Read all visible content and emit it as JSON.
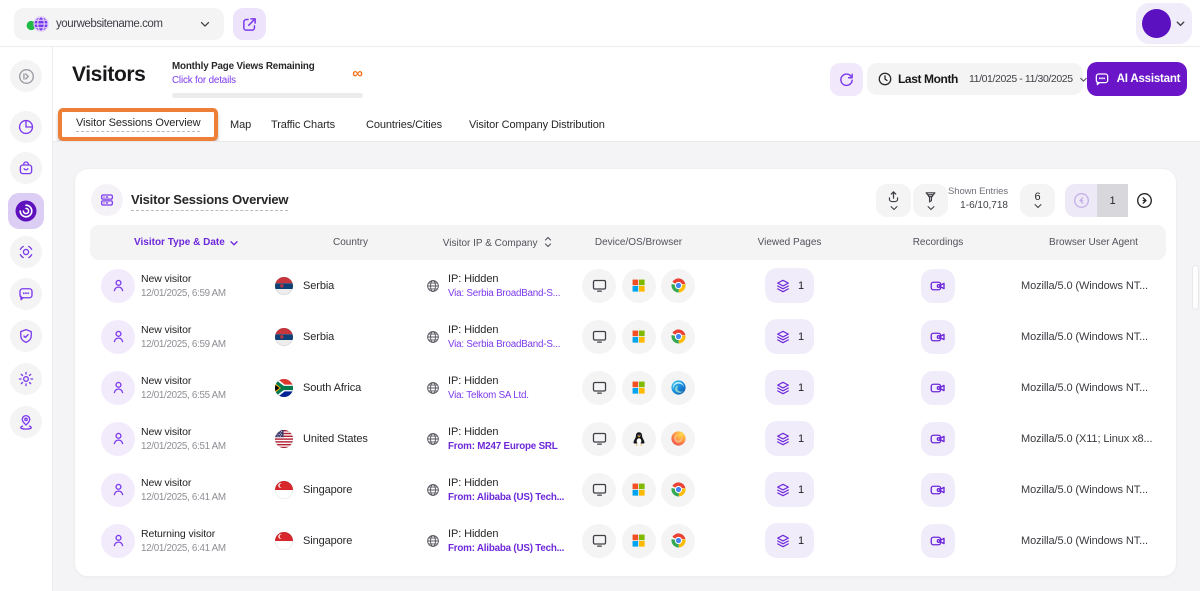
{
  "colors": {
    "primary": "#6a15c8",
    "purple": "#7c3aed",
    "purple_bold_text": "#6d28d9",
    "orange_highlight": "#ee7f37",
    "orange_infinity": "#f2711c",
    "page_bg": "#f4f4f6"
  },
  "topbar": {
    "site_name": "yourwebsitename.com",
    "site_icon": "globe-icon",
    "external_button_icon": "external-link-icon",
    "avatar_icon": "user-avatar"
  },
  "sidebar": {
    "items": [
      {
        "name": "collapse",
        "icon": "collapse-arrow-icon",
        "active": false
      },
      {
        "name": "dashboard",
        "icon": "pie-chart-icon",
        "active": false
      },
      {
        "name": "acquisition",
        "icon": "bag-icon",
        "active": false
      },
      {
        "name": "visitors",
        "icon": "visitors-radar-icon",
        "active": true
      },
      {
        "name": "behaviour",
        "icon": "orbit-icon",
        "active": false
      },
      {
        "name": "communication",
        "icon": "chat-bubble-icon",
        "active": false
      },
      {
        "name": "privacy",
        "icon": "shield-check-icon",
        "active": false
      },
      {
        "name": "settings",
        "icon": "gear-icon",
        "active": false
      },
      {
        "name": "location",
        "icon": "pin-icon",
        "active": false
      }
    ]
  },
  "header": {
    "title": "Visitors",
    "quota": {
      "title": "Monthly Page Views Remaining",
      "link": "Click for details",
      "value": "∞"
    },
    "period": {
      "label": "Last Month",
      "range": "11/01/2025 - 11/30/2025"
    },
    "ai_button": "AI Assistant"
  },
  "tabs": {
    "items": [
      {
        "label": "Visitor Sessions Overview",
        "active": true,
        "highlighted": true
      },
      {
        "label": "Map",
        "active": false
      },
      {
        "label": "Traffic Charts",
        "active": false
      },
      {
        "label": "Countries/Cities",
        "active": false
      },
      {
        "label": "Visitor Company Distribution",
        "active": false
      }
    ]
  },
  "card": {
    "title": "Visitor Sessions Overview",
    "shown_entries_label": "Shown Entries",
    "shown_entries_value": "1-6/10,718",
    "page_size": "6",
    "page_number": "1"
  },
  "table": {
    "columns": [
      "Visitor Type & Date",
      "Country",
      "Visitor IP & Company",
      "Device/OS/Browser",
      "Viewed Pages",
      "Recordings",
      "Browser User Agent"
    ],
    "rows": [
      {
        "type": "New visitor",
        "datetime": "12/01/2025, 6:59 AM",
        "country": "Serbia",
        "flag": "serbia",
        "ip": "IP: Hidden",
        "company": "Via: Serbia BroadBand-S...",
        "company_bold": false,
        "device": "desktop",
        "os": "windows",
        "browser": "chrome",
        "pages": "1",
        "user_agent": "Mozilla/5.0 (Windows NT..."
      },
      {
        "type": "New visitor",
        "datetime": "12/01/2025, 6:59 AM",
        "country": "Serbia",
        "flag": "serbia",
        "ip": "IP: Hidden",
        "company": "Via: Serbia BroadBand-S...",
        "company_bold": false,
        "device": "desktop",
        "os": "windows",
        "browser": "chrome",
        "pages": "1",
        "user_agent": "Mozilla/5.0 (Windows NT..."
      },
      {
        "type": "New visitor",
        "datetime": "12/01/2025, 6:55 AM",
        "country": "South Africa",
        "flag": "south-africa",
        "ip": "IP: Hidden",
        "company": "Via: Telkom SA Ltd.",
        "company_bold": false,
        "device": "desktop",
        "os": "windows",
        "browser": "edge",
        "pages": "1",
        "user_agent": "Mozilla/5.0 (Windows NT..."
      },
      {
        "type": "New visitor",
        "datetime": "12/01/2025, 6:51 AM",
        "country": "United States",
        "flag": "united-states",
        "ip": "IP: Hidden",
        "company": "From: M247 Europe SRL",
        "company_bold": true,
        "device": "desktop",
        "os": "linux",
        "browser": "firefox",
        "pages": "1",
        "user_agent": "Mozilla/5.0 (X11; Linux x8..."
      },
      {
        "type": "New visitor",
        "datetime": "12/01/2025, 6:41 AM",
        "country": "Singapore",
        "flag": "singapore",
        "ip": "IP: Hidden",
        "company": "From: Alibaba (US) Tech...",
        "company_bold": true,
        "device": "desktop",
        "os": "windows",
        "browser": "chrome",
        "pages": "1",
        "user_agent": "Mozilla/5.0 (Windows NT..."
      },
      {
        "type": "Returning visitor",
        "datetime": "12/01/2025, 6:41 AM",
        "country": "Singapore",
        "flag": "singapore",
        "ip": "IP: Hidden",
        "company": "From: Alibaba (US) Tech...",
        "company_bold": true,
        "device": "desktop",
        "os": "windows",
        "browser": "chrome",
        "pages": "1",
        "user_agent": "Mozilla/5.0 (Windows NT..."
      }
    ]
  }
}
